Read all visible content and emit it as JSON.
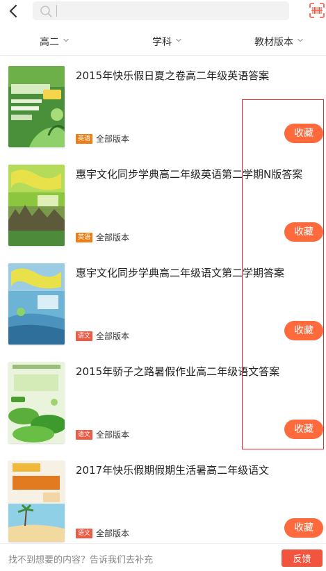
{
  "search": {
    "value": "",
    "placeholder": ""
  },
  "filters": [
    {
      "label": "高二"
    },
    {
      "label": "学科"
    },
    {
      "label": "教材版本"
    }
  ],
  "items": [
    {
      "title": "2015年快乐假日夏之卷高二年级英语答案",
      "subject": "英语",
      "version": "全部版本",
      "fav_label": "收藏"
    },
    {
      "title": "惠宇文化同步学典高二年级英语第二学期N版答案",
      "subject": "英语",
      "version": "全部版本",
      "fav_label": "收藏"
    },
    {
      "title": "惠宇文化同步学典高二年级语文第二学期答案",
      "subject": "语文",
      "version": "全部版本",
      "fav_label": "收藏"
    },
    {
      "title": "2015年骄子之路暑假作业高二年级语文答案",
      "subject": "语文",
      "version": "全部版本",
      "fav_label": "收藏"
    },
    {
      "title": "2017年快乐假期假期生活暑高二年级语文",
      "subject": "语文",
      "version": "全部版本",
      "fav_label": "收藏"
    }
  ],
  "footer": {
    "hint": "找不到想要的内容？告诉我们去补充",
    "feedback_label": "反馈"
  },
  "colors": {
    "accent": "#f2553f",
    "fav_button": "#ff6a3d",
    "tag_english": "#f07e16",
    "tag_chinese": "#ef5a45",
    "highlight_box": "#e52b2b"
  },
  "icons": {
    "back": "chevron-left-icon",
    "search": "search-icon",
    "scan": "scan-icon",
    "dropdown": "chevron-down-icon"
  }
}
